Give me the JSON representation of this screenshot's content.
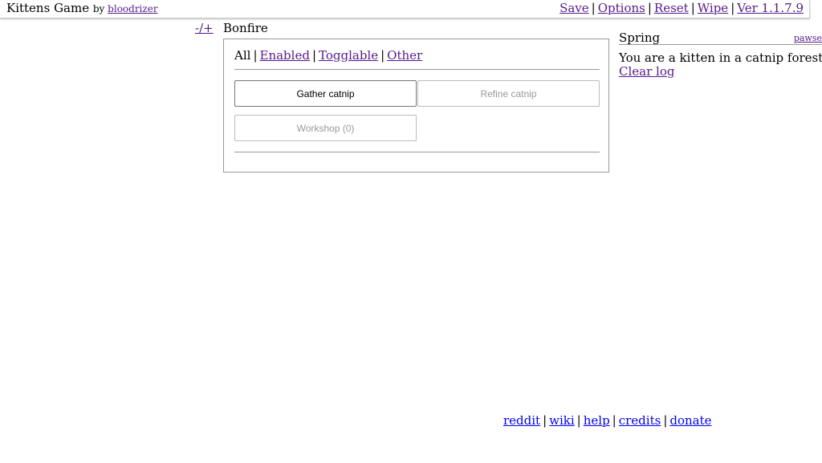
{
  "header": {
    "title": "Kittens Game",
    "by_label": "by",
    "author": "bloodrizer",
    "links": {
      "save": "Save",
      "options": "Options",
      "reset": "Reset",
      "wipe": "Wipe",
      "version": "Ver 1.1.7.9"
    },
    "separator": "|"
  },
  "left": {
    "toggle": "-/+",
    "tab_title": "Bonfire"
  },
  "bonfire": {
    "filters": {
      "all": "All",
      "enabled": "Enabled",
      "togglable": "Togglable",
      "other": "Other"
    },
    "buttons": [
      {
        "label": "Gather catnip",
        "state": "enabled"
      },
      {
        "label": "Refine catnip",
        "state": "disabled"
      },
      {
        "label": "Workshop (0)",
        "state": "disabled"
      }
    ]
  },
  "right": {
    "season": "Spring",
    "pause": "pawse",
    "log": [
      "You are a kitten in a catnip forest."
    ],
    "clear_log": "Clear log"
  },
  "footer": {
    "links": [
      "reddit",
      "wiki",
      "help",
      "credits",
      "donate"
    ]
  },
  "colors": {
    "link_visited": "#551a8b",
    "link": "#0000ee",
    "border": "#999999",
    "disabled_text": "#999999"
  }
}
